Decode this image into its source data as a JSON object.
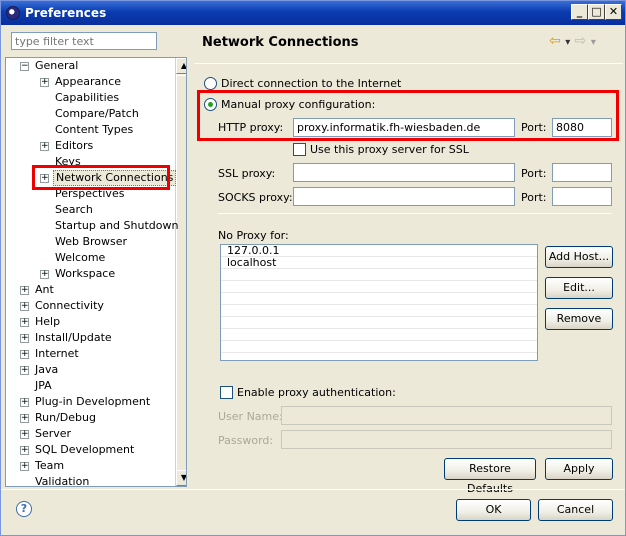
{
  "window": {
    "title": "Preferences"
  },
  "filter": {
    "placeholder": "type filter text"
  },
  "tree": [
    {
      "label": "General",
      "level": 0,
      "expanded": true
    },
    {
      "label": "Appearance",
      "level": 1,
      "expandable": true
    },
    {
      "label": "Capabilities",
      "level": 1
    },
    {
      "label": "Compare/Patch",
      "level": 1
    },
    {
      "label": "Content Types",
      "level": 1
    },
    {
      "label": "Editors",
      "level": 1,
      "expandable": true
    },
    {
      "label": "Keys",
      "level": 1
    },
    {
      "label": "Network Connections",
      "level": 1,
      "expandable": true,
      "selected": true
    },
    {
      "label": "Perspectives",
      "level": 1
    },
    {
      "label": "Search",
      "level": 1
    },
    {
      "label": "Startup and Shutdown",
      "level": 1
    },
    {
      "label": "Web Browser",
      "level": 1
    },
    {
      "label": "Welcome",
      "level": 1
    },
    {
      "label": "Workspace",
      "level": 1,
      "expandable": true
    },
    {
      "label": "Ant",
      "level": 0,
      "expandable": true
    },
    {
      "label": "Connectivity",
      "level": 0,
      "expandable": true
    },
    {
      "label": "Help",
      "level": 0,
      "expandable": true
    },
    {
      "label": "Install/Update",
      "level": 0,
      "expandable": true
    },
    {
      "label": "Internet",
      "level": 0,
      "expandable": true
    },
    {
      "label": "Java",
      "level": 0,
      "expandable": true
    },
    {
      "label": "JPA",
      "level": 0
    },
    {
      "label": "Plug-in Development",
      "level": 0,
      "expandable": true
    },
    {
      "label": "Run/Debug",
      "level": 0,
      "expandable": true
    },
    {
      "label": "Server",
      "level": 0,
      "expandable": true
    },
    {
      "label": "SQL Development",
      "level": 0,
      "expandable": true
    },
    {
      "label": "Team",
      "level": 0,
      "expandable": true
    },
    {
      "label": "Validation",
      "level": 0
    }
  ],
  "page": {
    "title": "Network Connections",
    "direct_label": "Direct connection to the Internet",
    "manual_label": "Manual proxy configuration:",
    "http_proxy_label": "HTTP proxy:",
    "http_proxy_value": "proxy.informatik.fh-wiesbaden.de",
    "port_label": "Port:",
    "http_port_value": "8080",
    "ssl_same_label": "Use this proxy server for SSL",
    "ssl_proxy_label": "SSL proxy:",
    "socks_proxy_label": "SOCKS proxy:",
    "no_proxy_label": "No Proxy for:",
    "no_proxy_hosts": [
      "127.0.0.1",
      "localhost"
    ],
    "add_host_button": "Add Host...",
    "edit_button": "Edit...",
    "remove_button": "Remove",
    "enable_auth_label": "Enable proxy authentication:",
    "user_name_label": "User Name:",
    "password_label": "Password:",
    "restore_defaults_button": "Restore Defaults",
    "apply_button": "Apply"
  },
  "dialog": {
    "ok_button": "OK",
    "cancel_button": "Cancel"
  },
  "icons": {
    "help": "?",
    "back": "⇦",
    "forward": "⇨",
    "dropdown": "▾"
  },
  "colors": {
    "highlight": "#e00000",
    "title_bar": "#0a3cb0"
  }
}
